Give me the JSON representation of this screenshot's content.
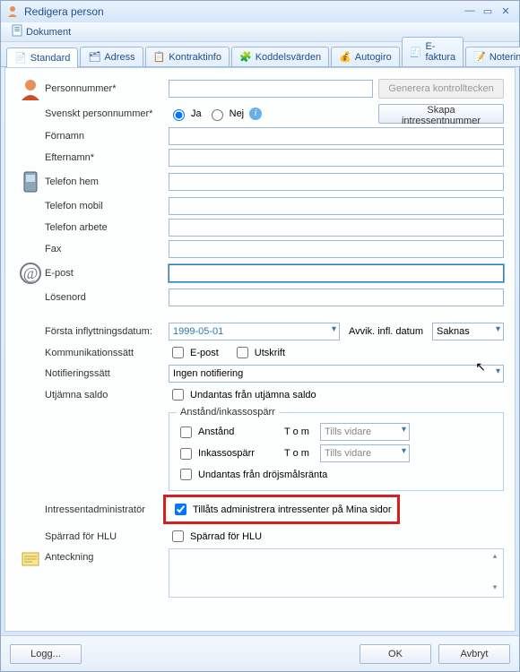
{
  "window": {
    "title": "Redigera person"
  },
  "menu": {
    "dokument": "Dokument"
  },
  "tabs": {
    "standard": "Standard",
    "adress": "Adress",
    "kontraktinfo": "Kontraktinfo",
    "koddelsvarden": "Koddelsvärden",
    "autogiro": "Autogiro",
    "efaktura": "E-faktura",
    "noteringar": "Noteringar"
  },
  "labels": {
    "personnummer": "Personnummer*",
    "svenskt_pn": "Svenskt personnummer*",
    "fornamn": "Förnamn",
    "efternamn": "Efternamn*",
    "telefon_hem": "Telefon hem",
    "telefon_mobil": "Telefon mobil",
    "telefon_arbete": "Telefon arbete",
    "fax": "Fax",
    "epost": "E-post",
    "losenord": "Lösenord",
    "forsta_inflytt": "Första inflyttningsdatum:",
    "kommunikation": "Kommunikationssätt",
    "notifiering": "Notifieringssätt",
    "utjamna": "Utjämna saldo",
    "intressentadmin": "Intressentadministratör",
    "sparrad_hlu": "Spärrad för HLU",
    "anteckning": "Anteckning",
    "avvik_infl": "Avvik. infl. datum",
    "tom": "T o m"
  },
  "values": {
    "ja": "Ja",
    "nej": "Nej",
    "forsta_inflytt_date": "1999-05-01",
    "avvik_infl": "Saknas",
    "notifiering_sel": "Ingen notifiering",
    "tills_vidare": "Tills vidare"
  },
  "checkboxes": {
    "epost": "E-post",
    "utskrift": "Utskrift",
    "undantas_utjamna": "Undantas från utjämna saldo",
    "anstand": "Anstånd",
    "inkassosparr": "Inkassospärr",
    "undantas_drojsmal": "Undantas från dröjsmålsränta",
    "tillats_admin": "Tillåts administrera intressenter på Mina sidor",
    "sparrad_hlu": "Spärrad för HLU"
  },
  "groups": {
    "anstand": "Anstånd/inkassospärr"
  },
  "buttons": {
    "generera": "Generera kontrolltecken",
    "skapa_intr": "Skapa intressentnummer",
    "logg": "Logg...",
    "ok": "OK",
    "avbryt": "Avbryt"
  }
}
